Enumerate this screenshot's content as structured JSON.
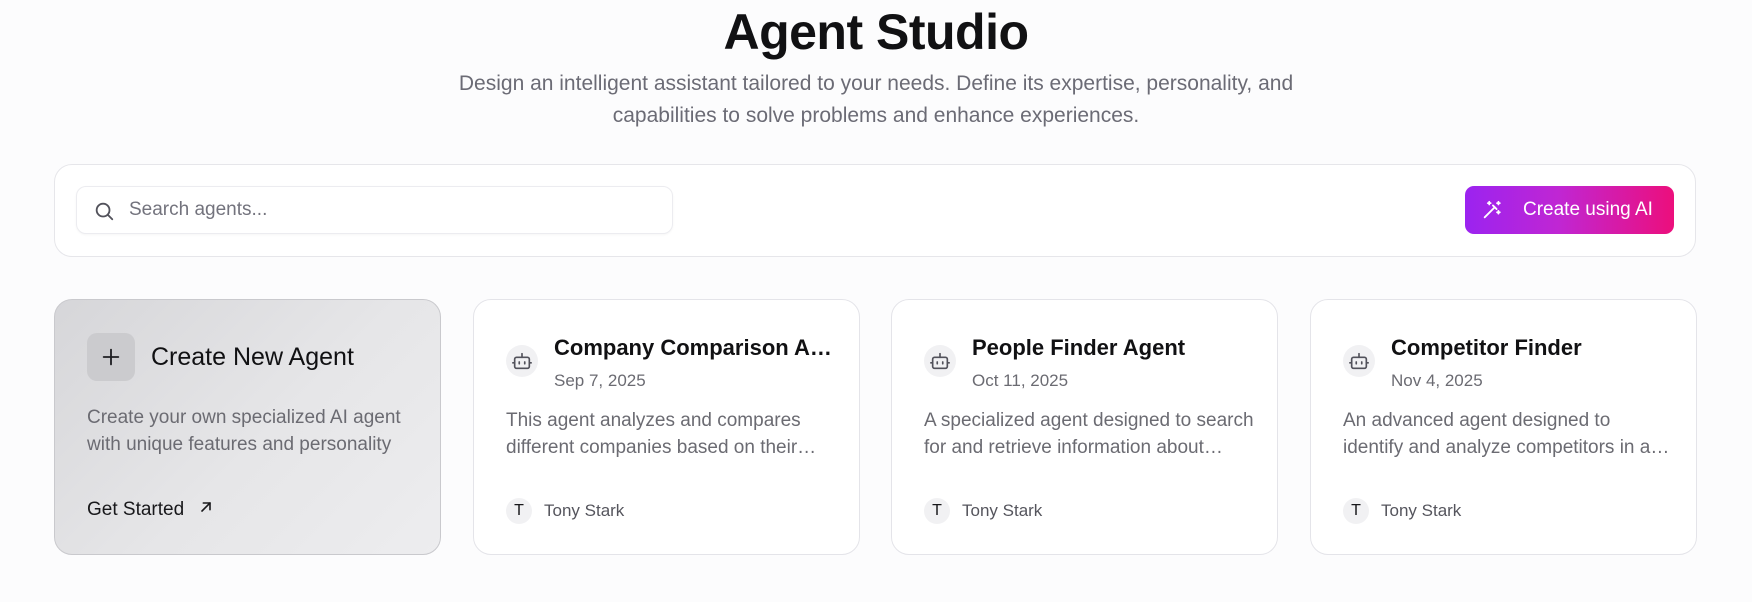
{
  "header": {
    "title": "Agent Studio",
    "subtitle": "Design an intelligent assistant tailored to your needs. Define its expertise, personality, and capabilities to solve problems and enhance experiences."
  },
  "search": {
    "placeholder": "Search agents...",
    "value": "",
    "icon": "search-icon"
  },
  "create_ai_button": {
    "label": "Create using AI",
    "icon": "magic-wand-icon"
  },
  "colors": {
    "gradient_start": "#9b23f0",
    "gradient_end": "#ec0f7c",
    "page_background": "#fcfcfd"
  },
  "create_card": {
    "title": "Create New Agent",
    "description": "Create your own specialized AI agent with unique features and personality",
    "cta": "Get Started",
    "icon": "plus-icon",
    "cta_icon": "arrow-up-right-icon"
  },
  "agents": [
    {
      "name": "Company Comparison Agent",
      "date": "Sep 7, 2025",
      "description": "This agent analyzes and compares different companies based on their financials and market position.",
      "owner_initial": "T",
      "owner": "Tony Stark",
      "icon": "bot-icon"
    },
    {
      "name": "People Finder Agent",
      "date": "Oct 11, 2025",
      "description": "A specialized agent designed to search for and retrieve information about people.",
      "owner_initial": "T",
      "owner": "Tony Stark",
      "icon": "bot-icon"
    },
    {
      "name": "Competitor Finder",
      "date": "Nov 4, 2025",
      "description": "An advanced agent designed to identify and analyze competitors in a market.",
      "owner_initial": "T",
      "owner": "Tony Stark",
      "icon": "bot-icon"
    }
  ]
}
